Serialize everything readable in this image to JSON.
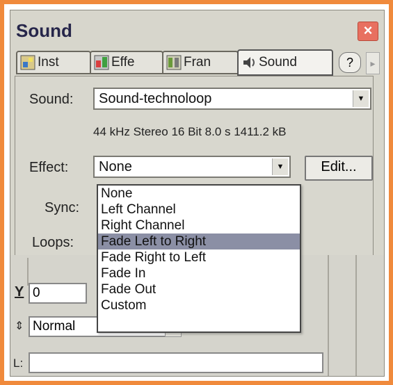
{
  "window": {
    "title": "Sound",
    "close_icon": "×"
  },
  "tabs": [
    {
      "label": "Inst",
      "icon": "instance-icon"
    },
    {
      "label": "Effe",
      "icon": "effect-icon"
    },
    {
      "label": "Fran",
      "icon": "frame-icon"
    },
    {
      "label": "Sound",
      "icon": "sound-icon"
    }
  ],
  "tab_help": "?",
  "tab_arrow": "▸",
  "sound": {
    "label": "Sound:",
    "value": "Sound-technoloop"
  },
  "sound_info": "44 kHz Stereo 16 Bit 8.0 s 1411.2 kB",
  "effect": {
    "label": "Effect:",
    "value": "None",
    "edit_label": "Edit...",
    "options": [
      "None",
      "Left Channel",
      "Right Channel",
      "Fade Left to Right",
      "Fade Right to Left",
      "Fade In",
      "Fade Out",
      "Custom"
    ],
    "highlighted": "Fade Left to Right"
  },
  "sync": {
    "label": "Sync:"
  },
  "loops": {
    "label": "Loops:"
  },
  "lower": {
    "y_label": "Y",
    "y_value": "0",
    "mode_value": "Normal",
    "l_label": "L:"
  },
  "colors": {
    "frame": "#f08a3c",
    "panel": "#d7d6cc",
    "highlight": "#8b8fa5"
  }
}
